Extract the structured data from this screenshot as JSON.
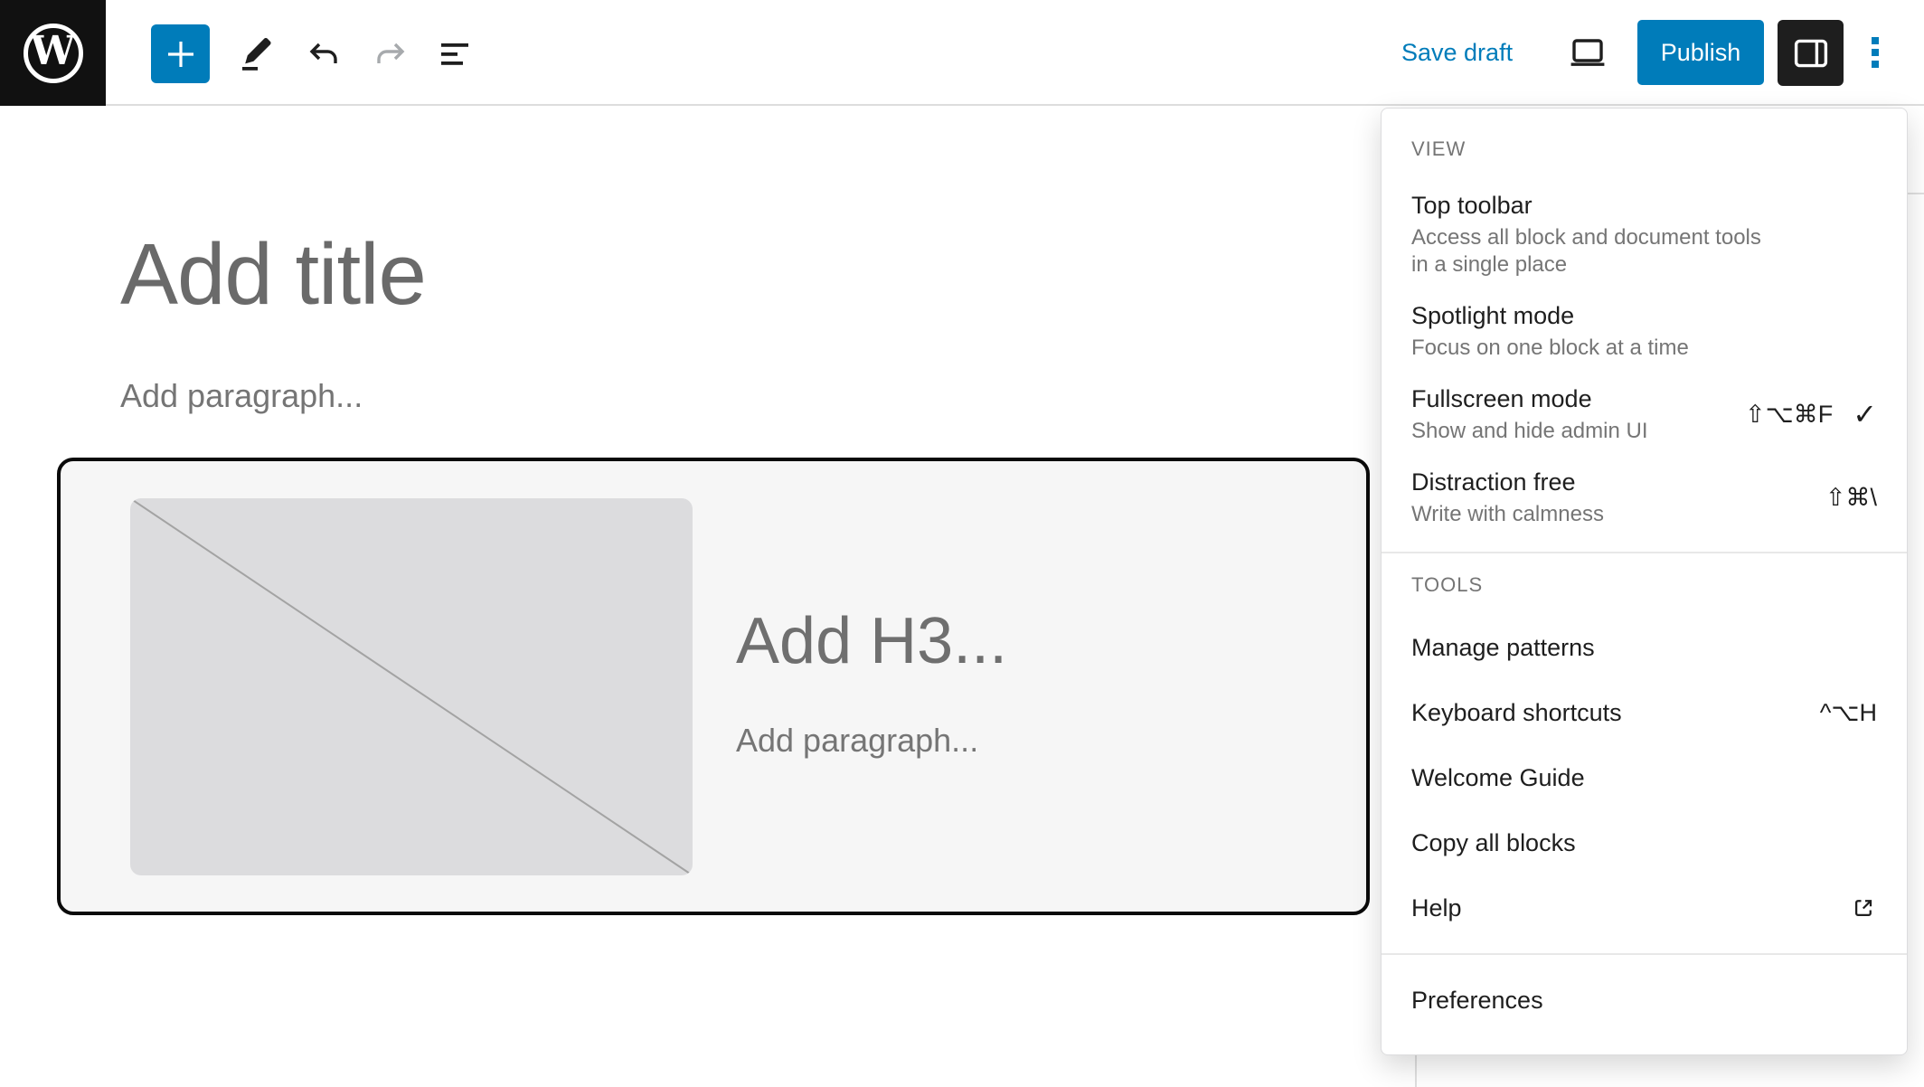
{
  "header": {
    "logo_letter": "W",
    "save_draft_label": "Save draft",
    "publish_label": "Publish",
    "icons": [
      "plus-icon",
      "pencil-icon",
      "undo-arrow-icon",
      "redo-arrow-icon",
      "list-view-icon",
      "laptop-icon",
      "sidebar-panel-icon",
      "vertical-dots-icon"
    ]
  },
  "canvas": {
    "title_placeholder": "Add title",
    "paragraph_placeholder": "Add paragraph...",
    "media_text_block": {
      "heading_placeholder": "Add H3...",
      "paragraph_placeholder": "Add paragraph...",
      "image_placeholder": "empty-image-placeholder"
    }
  },
  "options_menu": {
    "sections": [
      {
        "label": "VIEW",
        "items": [
          {
            "label": "Top toolbar",
            "description": "Access all block and document tools in a single place"
          },
          {
            "label": "Spotlight mode",
            "description": "Focus on one block at a time"
          },
          {
            "label": "Fullscreen mode",
            "description": "Show and hide admin UI",
            "shortcut": "⇧⌥⌘F",
            "checked": true
          },
          {
            "label": "Distraction free",
            "description": "Write with calmness",
            "shortcut": "⇧⌘\\"
          }
        ]
      },
      {
        "label": "TOOLS",
        "items": [
          {
            "label": "Manage patterns"
          },
          {
            "label": "Keyboard shortcuts",
            "shortcut": "^⌥H"
          },
          {
            "label": "Welcome Guide"
          },
          {
            "label": "Copy all blocks"
          },
          {
            "label": "Help",
            "external": true
          }
        ]
      },
      {
        "label": "",
        "items": [
          {
            "label": "Preferences"
          }
        ]
      }
    ]
  },
  "colors": {
    "accent": "#007cba",
    "text": "#1e1e1e",
    "muted": "#757575",
    "border": "#e0e0e0",
    "block_border": "#0a0a0a",
    "placeholder_bg": "#dcdcde",
    "disabled_icon": "#a7aaad"
  }
}
